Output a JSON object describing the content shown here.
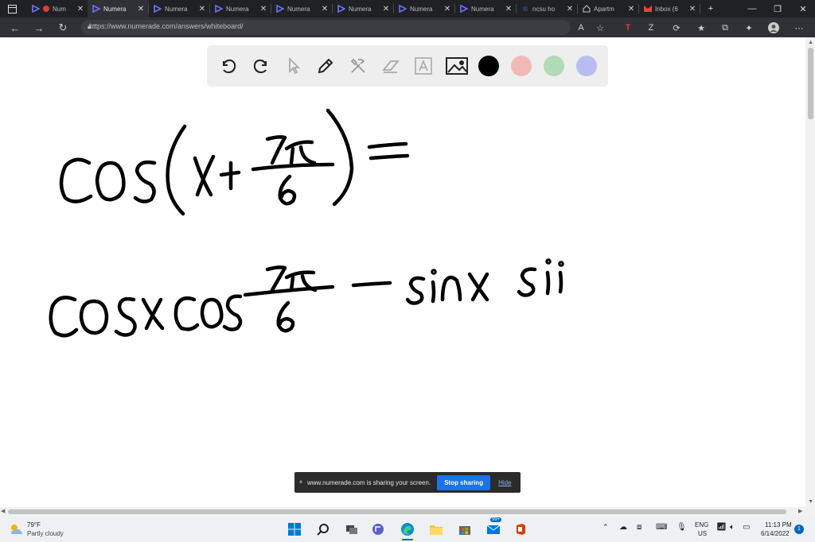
{
  "tabs": [
    {
      "title": "Num",
      "favicon": "numerade-favicon",
      "recording": true
    },
    {
      "title": "Numera",
      "favicon": "numerade-favicon",
      "active": true
    },
    {
      "title": "Numera",
      "favicon": "numerade-favicon"
    },
    {
      "title": "Numera",
      "favicon": "numerade-favicon"
    },
    {
      "title": "Numera",
      "favicon": "numerade-favicon"
    },
    {
      "title": "Numera",
      "favicon": "numerade-favicon"
    },
    {
      "title": "Numera",
      "favicon": "numerade-favicon"
    },
    {
      "title": "Numera",
      "favicon": "numerade-favicon"
    },
    {
      "title": "ncsu ho",
      "favicon": "ncsu-favicon"
    },
    {
      "title": "Apartm",
      "favicon": "home-icon"
    },
    {
      "title": "Inbox (6",
      "favicon": "gmail-icon"
    }
  ],
  "address": {
    "url": "https://www.numerade.com/answers/whiteboard/"
  },
  "whiteboard": {
    "colors": [
      "#000000",
      "#f2b8b8",
      "#b3dab7",
      "#b7bdf0"
    ],
    "line1": {
      "func": "cos",
      "var": "x",
      "plus": "+",
      "numerator": "7π",
      "denominator": "6",
      "equals": "="
    },
    "line2": {
      "cosx": "cosx",
      "cos": "cos",
      "numerator": "7π",
      "denominator": "6",
      "minus": "−",
      "sinx": "sinx",
      "partial": "si"
    }
  },
  "share_bar": {
    "message": "www.numerade.com is sharing your screen.",
    "stop_label": "Stop sharing",
    "hide_label": "Hide"
  },
  "taskbar": {
    "weather_temp": "79°F",
    "weather_desc": "Partly cloudy",
    "lang_top": "ENG",
    "lang_bottom": "US",
    "time": "11:13 PM",
    "date": "6/14/2022",
    "notification_count": "1",
    "teams_badge": "99+"
  }
}
